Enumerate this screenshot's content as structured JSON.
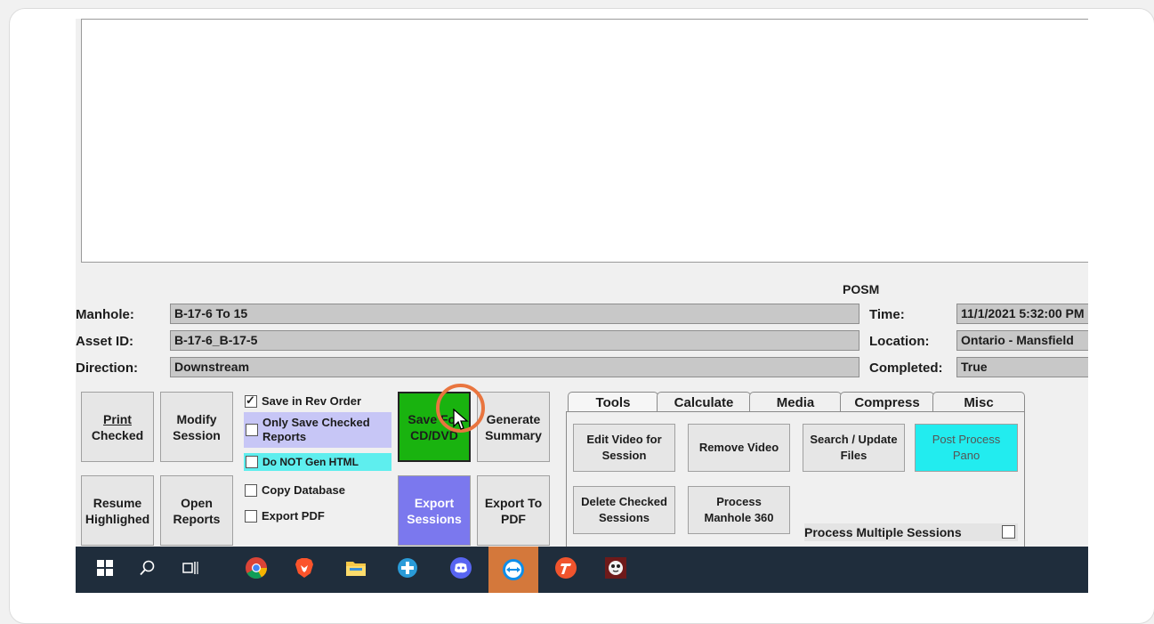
{
  "labels": {
    "posm": "POSM",
    "manhole": "Manhole:",
    "asset_id": "Asset ID:",
    "direction": "Direction:",
    "time": "Time:",
    "location": "Location:",
    "completed": "Completed:"
  },
  "fields": {
    "manhole": "B-17-6 To 15",
    "asset_id": "B-17-6_B-17-5",
    "direction": "Downstream",
    "time": "11/1/2021 5:32:00 PM",
    "location": "Ontario - Mansfield",
    "completed": "True"
  },
  "buttons": {
    "print_checked": [
      "Print",
      "Checked"
    ],
    "modify_session": [
      "Modify",
      "Session"
    ],
    "resume_highlighted": [
      "Resume",
      "Highlighed"
    ],
    "open_reports": [
      "Open",
      "Reports"
    ],
    "save_for_cd": [
      "Save For",
      "CD/DVD"
    ],
    "generate_summary": [
      "Generate",
      "Summary"
    ],
    "export_sessions": [
      "Export",
      "Sessions"
    ],
    "export_to_pdf": [
      "Export To",
      "PDF"
    ],
    "edit_video": [
      "Edit Video for",
      "Session"
    ],
    "remove_video": "Remove Video",
    "search_update": [
      "Search / Update",
      "Files"
    ],
    "post_process": [
      "Post Process",
      "Pano"
    ],
    "delete_checked": [
      "Delete Checked",
      "Sessions"
    ],
    "process_manhole": [
      "Process",
      "Manhole 360"
    ]
  },
  "checkboxes": {
    "save_rev_order": "Save in Rev Order",
    "only_save_checked": "Only Save Checked Reports",
    "do_not_gen_html": "Do NOT Gen HTML",
    "copy_database": "Copy Database",
    "export_pdf": "Export PDF",
    "process_multiple": "Process Multiple Sessions"
  },
  "tabs": [
    "Tools",
    "Calculate",
    "Media",
    "Compress",
    "Misc"
  ],
  "colors": {
    "save_btn": "#19b30f",
    "export_btn": "#7b78ee",
    "post_process_btn": "#22ecef",
    "only_save_bg": "#c7c6f6",
    "do_not_gen_bg": "#5eeeee",
    "taskbar": "#1f2d3c",
    "cursor_ring": "#e9753f"
  },
  "taskbar_icons": [
    "windows-start-icon",
    "search-icon",
    "task-view-icon",
    "chrome-icon",
    "brave-icon",
    "file-explorer-icon",
    "app-plus-icon",
    "discord-icon",
    "teamviewer-icon",
    "app-t-icon",
    "app-face-icon"
  ]
}
